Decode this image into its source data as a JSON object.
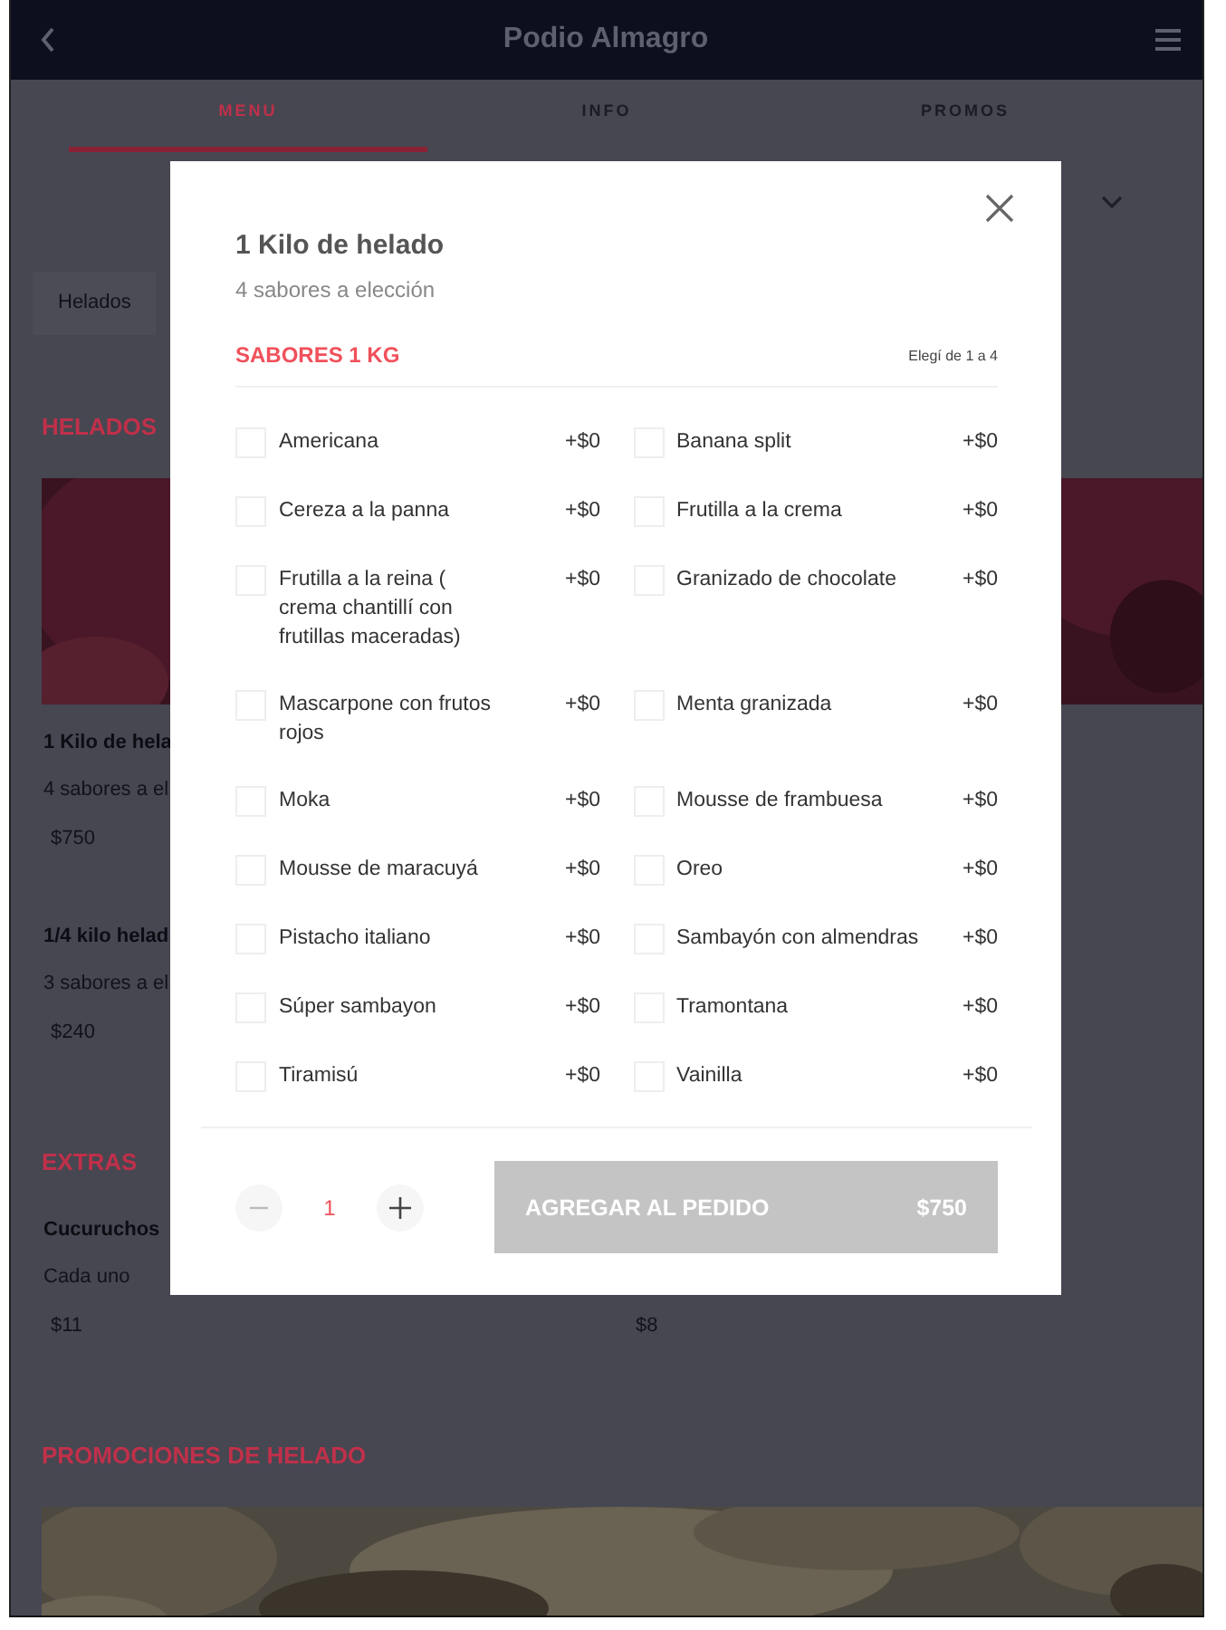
{
  "header": {
    "title": "Podio Almagro"
  },
  "tabs": [
    {
      "label": "MENU",
      "selected": true
    },
    {
      "label": "INFO",
      "selected": false
    },
    {
      "label": "PROMOS",
      "selected": false
    }
  ],
  "category": "Helados",
  "sections": [
    {
      "title": "HELADOS",
      "kind": "list",
      "banner": {
        "kind": "picture"
      },
      "items": [
        {
          "name": "1 Kilo de hela",
          "description": "4 sabores a el",
          "price": "$750"
        },
        {
          "name": "1/4 kilo helad",
          "description": "3 sabores a el",
          "price": "$240"
        }
      ]
    },
    {
      "title": "EXTRAS",
      "kind": "grid",
      "items": [
        {
          "name": "Cucuruchos",
          "description": "Cada uno",
          "price": "$11"
        },
        {
          "price": "$8"
        }
      ]
    },
    {
      "title": "PROMOCIONES DE HELADO",
      "kind": "list",
      "banner": {
        "kind": "picture"
      }
    }
  ],
  "modal": {
    "title": "1 Kilo de helado",
    "subtitle": "4 sabores a elección",
    "group": {
      "title": "SABORES 1 KG",
      "hint": "Elegí de 1 a 4",
      "options": [
        {
          "name": "Americana",
          "price": "+$0",
          "checked": false
        },
        {
          "name": "Banana split",
          "price": "+$0",
          "checked": false
        },
        {
          "name": "Cereza a la panna",
          "price": "+$0",
          "checked": false
        },
        {
          "name": "Frutilla a la crema",
          "price": "+$0",
          "checked": false
        },
        {
          "name": "Frutilla a la reina ( crema chantillí con frutillas maceradas)",
          "price": "+$0",
          "checked": false
        },
        {
          "name": "Granizado de chocolate",
          "price": "+$0",
          "checked": false
        },
        {
          "name": "Mascarpone con frutos rojos",
          "price": "+$0",
          "checked": false
        },
        {
          "name": "Menta granizada",
          "price": "+$0",
          "checked": false
        },
        {
          "name": "Moka",
          "price": "+$0",
          "checked": false
        },
        {
          "name": "Mousse de frambuesa",
          "price": "+$0",
          "checked": false
        },
        {
          "name": "Mousse de maracuyá",
          "price": "+$0",
          "checked": false
        },
        {
          "name": "Oreo",
          "price": "+$0",
          "checked": false
        },
        {
          "name": "Pistacho italiano",
          "price": "+$0",
          "checked": false
        },
        {
          "name": "Sambayón con almendras",
          "price": "+$0",
          "checked": false
        },
        {
          "name": "Súper sambayon",
          "price": "+$0",
          "checked": false
        },
        {
          "name": "Tramontana",
          "price": "+$0",
          "checked": false
        },
        {
          "name": "Tiramisú",
          "price": "+$0",
          "checked": false
        },
        {
          "name": "Vainilla",
          "price": "+$0",
          "checked": false
        }
      ]
    },
    "quantity": "1",
    "add_button": {
      "label": "AGREGAR AL PEDIDO",
      "price": "$750"
    }
  }
}
